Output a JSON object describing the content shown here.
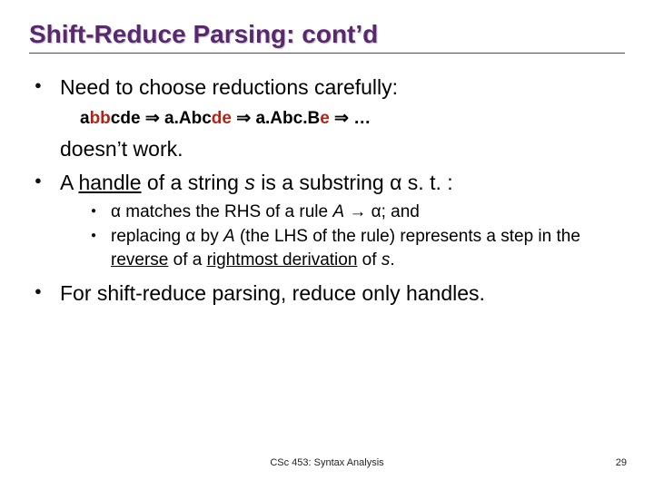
{
  "slide": {
    "title": "Shift-Reduce Parsing: cont’d",
    "bullets": {
      "b1": "Need to choose reductions carefully:",
      "example": {
        "w0_a": "a",
        "w0_bb": "bb",
        "w0_cde": "cde",
        "arr1": " ⇒ ",
        "w1_aAbc": "a.Abc",
        "w1_de": "de",
        "arr2": " ⇒ ",
        "w2_aAbcB": "a.Abc.B",
        "w2_e": "e",
        "arr3": " ⇒ …"
      },
      "cont1": "doesn’t work.",
      "b2_pre": "A ",
      "b2_handle": "handle",
      "b2_mid": " of a string ",
      "b2_s": "s",
      "b2_post1": " is a substring ",
      "b2_alpha": "α",
      "b2_post2": " s. t. :",
      "sub1_alpha": "α",
      "sub1_mid1": " matches the RHS of a rule ",
      "sub1_A": "A",
      "sub1_arrow": " → ",
      "sub1_alpha2": "α",
      "sub1_end": "; and",
      "sub2_pre": "replacing ",
      "sub2_alpha": "α",
      "sub2_mid1": " by ",
      "sub2_A": "A",
      "sub2_mid2": " (the LHS of the rule) represents a step in the ",
      "sub2_reverse": "reverse",
      "sub2_mid3": " of a ",
      "sub2_rightmost": "rightmost derivation",
      "sub2_mid4": " of ",
      "sub2_s": "s",
      "sub2_end": ".",
      "b3": "For shift-reduce parsing, reduce only handles."
    },
    "footer": "CSc 453: Syntax Analysis",
    "page": "29"
  }
}
